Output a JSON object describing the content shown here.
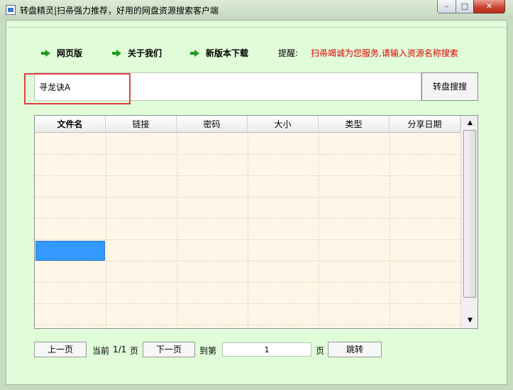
{
  "window": {
    "title": "转盘精灵|扫帚强力推荐，好用的网盘资源搜索客户端",
    "min_symbol": "–",
    "max_symbol": "□",
    "close_symbol": "✕"
  },
  "nav": {
    "items": [
      {
        "label": "网页版",
        "icon": "green-arrow-icon"
      },
      {
        "label": "关于我们",
        "icon": "green-arrow-icon"
      },
      {
        "label": "新版本下载",
        "icon": "green-arrow-icon"
      }
    ],
    "notice_label": "提醒:",
    "notice_text": "扫帚竭诚为您服务,请输入资源名称搜索",
    "notice_color": "#e00000"
  },
  "search": {
    "value": "寻龙诀A",
    "button_label": "转盘搜搜"
  },
  "table": {
    "columns": [
      "文件名",
      "链接",
      "密码",
      "大小",
      "类型",
      "分享日期"
    ],
    "rows": []
  },
  "scrollbar": {
    "up_symbol": "▲",
    "down_symbol": "▼"
  },
  "pager": {
    "prev_label": "上一页",
    "current_prefix": "当前",
    "current_value": "1/1",
    "current_suffix": "页",
    "next_label": "下一页",
    "goto_prefix": "到第",
    "goto_value": "1",
    "goto_suffix": "页",
    "jump_label": "跳转"
  },
  "colors": {
    "background": "#e0fcd8",
    "table_background": "#fef6e6",
    "selection": "#3399ff",
    "highlight_border": "#e04040"
  }
}
